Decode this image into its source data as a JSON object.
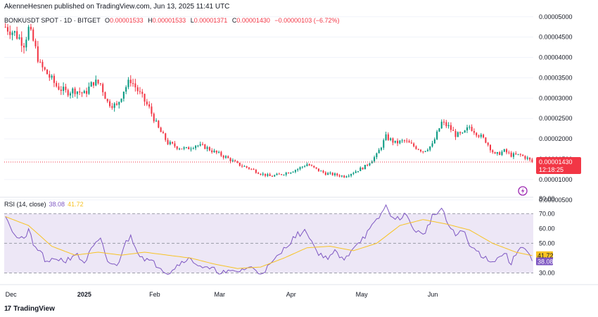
{
  "header": {
    "publisher": "AkenneHesnen published on TradingView.com, Jun 13, 2025 11:41 UTC"
  },
  "legend": {
    "symbol": "BONKUSDT SPOT · 1D · BITGET",
    "open_label": "O",
    "open": "0.00001533",
    "high_label": "H",
    "high": "0.00001533",
    "low_label": "L",
    "low": "0.00001371",
    "close_label": "C",
    "close": "0.00001430",
    "change": "−0.00000103 (−6.72%)"
  },
  "rsi_legend": {
    "label": "RSI (14, close)",
    "rsi_value": "38.08",
    "ma_value": "41.72"
  },
  "footer": {
    "brand": "TradingView",
    "logo": "17"
  },
  "colors": {
    "up": "#089981",
    "down": "#f23645",
    "rsi": "#7e57c2",
    "rsi_ma": "#f7c325",
    "band": "#ede7f6"
  },
  "icons": {
    "alert": "lightning-icon"
  },
  "chart_data": [
    {
      "type": "candlestick",
      "ylim": [
        6e-06,
        5.1e-05
      ],
      "y_ticks": [
        "0.00005000",
        "0.00004500",
        "0.00004000",
        "0.00003500",
        "0.00003000",
        "0.00002500",
        "0.00002000",
        "0.00001500",
        "0.00001000",
        "0.00000500"
      ],
      "x_ticks": [
        "Dec",
        "2025",
        "Feb",
        "Mar",
        "Apr",
        "May",
        "Jun"
      ],
      "last_price_label": "0.00001430",
      "countdown": "12:18:25",
      "price_path": [
        [
          0,
          4.75e-05
        ],
        [
          4,
          4.6e-05
        ],
        [
          8,
          4.35e-05
        ],
        [
          10,
          4.7e-05
        ],
        [
          12,
          4.4e-05
        ],
        [
          15,
          3.8e-05
        ],
        [
          18,
          3.6e-05
        ],
        [
          22,
          3.3e-05
        ],
        [
          26,
          3.15e-05
        ],
        [
          30,
          3.2e-05
        ],
        [
          34,
          3.1e-05
        ],
        [
          38,
          3.4e-05
        ],
        [
          41,
          3.35e-05
        ],
        [
          44,
          2.9e-05
        ],
        [
          48,
          2.8e-05
        ],
        [
          51,
          3.2e-05
        ],
        [
          54,
          3.45e-05
        ],
        [
          58,
          3.1e-05
        ],
        [
          62,
          2.75e-05
        ],
        [
          66,
          2.25e-05
        ],
        [
          70,
          1.9e-05
        ],
        [
          74,
          1.8e-05
        ],
        [
          78,
          1.75e-05
        ],
        [
          82,
          1.85e-05
        ],
        [
          86,
          1.8e-05
        ],
        [
          90,
          1.68e-05
        ],
        [
          95,
          1.55e-05
        ],
        [
          100,
          1.38e-05
        ],
        [
          105,
          1.28e-05
        ],
        [
          110,
          1.15e-05
        ],
        [
          114,
          1.08e-05
        ],
        [
          118,
          1.12e-05
        ],
        [
          122,
          1.18e-05
        ],
        [
          126,
          1.26e-05
        ],
        [
          130,
          1.38e-05
        ],
        [
          134,
          1.25e-05
        ],
        [
          138,
          1.15e-05
        ],
        [
          142,
          1.12e-05
        ],
        [
          146,
          1.08e-05
        ],
        [
          150,
          1.18e-05
        ],
        [
          155,
          1.32e-05
        ],
        [
          160,
          1.6e-05
        ],
        [
          164,
          2.05e-05
        ],
        [
          168,
          1.9e-05
        ],
        [
          172,
          1.95e-05
        ],
        [
          176,
          1.82e-05
        ],
        [
          180,
          1.7e-05
        ],
        [
          184,
          1.85e-05
        ],
        [
          188,
          2.4e-05
        ],
        [
          191,
          2.3e-05
        ],
        [
          194,
          2.1e-05
        ],
        [
          197,
          2.1e-05
        ],
        [
          200,
          2.3e-05
        ],
        [
          203,
          2.15e-05
        ],
        [
          207,
          1.95e-05
        ],
        [
          211,
          1.6e-05
        ],
        [
          215,
          1.7e-05
        ],
        [
          218,
          1.6e-05
        ],
        [
          222,
          1.6e-05
        ],
        [
          225,
          1.52e-05
        ],
        [
          227,
          1.43e-05
        ]
      ]
    },
    {
      "type": "line",
      "title": "RSI (14, close)",
      "ylim": [
        25,
        82
      ],
      "y_ticks": [
        "80.00",
        "70.00",
        "60.00",
        "50.00",
        "30.00"
      ],
      "bands": [
        30,
        50,
        70
      ],
      "current_rsi": 38.08,
      "current_ma": 41.72,
      "rsi_path": [
        [
          0,
          70
        ],
        [
          4,
          55
        ],
        [
          8,
          52
        ],
        [
          10,
          60
        ],
        [
          12,
          48
        ],
        [
          15,
          45
        ],
        [
          18,
          36
        ],
        [
          22,
          40
        ],
        [
          26,
          38
        ],
        [
          30,
          43
        ],
        [
          34,
          37
        ],
        [
          38,
          48
        ],
        [
          41,
          52
        ],
        [
          44,
          38
        ],
        [
          48,
          34
        ],
        [
          51,
          48
        ],
        [
          54,
          55
        ],
        [
          58,
          42
        ],
        [
          62,
          38
        ],
        [
          66,
          35
        ],
        [
          70,
          30
        ],
        [
          74,
          35
        ],
        [
          78,
          40
        ],
        [
          82,
          37
        ],
        [
          86,
          33
        ],
        [
          90,
          32
        ],
        [
          95,
          30
        ],
        [
          100,
          31
        ],
        [
          105,
          34
        ],
        [
          110,
          30
        ],
        [
          114,
          35
        ],
        [
          118,
          42
        ],
        [
          122,
          50
        ],
        [
          126,
          56
        ],
        [
          130,
          58
        ],
        [
          134,
          45
        ],
        [
          138,
          40
        ],
        [
          142,
          44
        ],
        [
          146,
          38
        ],
        [
          150,
          48
        ],
        [
          155,
          55
        ],
        [
          160,
          65
        ],
        [
          164,
          75
        ],
        [
          168,
          65
        ],
        [
          172,
          70
        ],
        [
          176,
          60
        ],
        [
          180,
          55
        ],
        [
          184,
          68
        ],
        [
          188,
          73
        ],
        [
          191,
          62
        ],
        [
          194,
          55
        ],
        [
          197,
          60
        ],
        [
          200,
          48
        ],
        [
          203,
          45
        ],
        [
          207,
          40
        ],
        [
          211,
          38
        ],
        [
          215,
          44
        ],
        [
          218,
          36
        ],
        [
          222,
          49
        ],
        [
          225,
          44
        ],
        [
          227,
          38
        ]
      ],
      "ma_path": [
        [
          0,
          68
        ],
        [
          10,
          62
        ],
        [
          20,
          48
        ],
        [
          30,
          42
        ],
        [
          40,
          44
        ],
        [
          50,
          42
        ],
        [
          60,
          44
        ],
        [
          70,
          42
        ],
        [
          80,
          40
        ],
        [
          90,
          36
        ],
        [
          100,
          33
        ],
        [
          110,
          34
        ],
        [
          120,
          40
        ],
        [
          130,
          47
        ],
        [
          140,
          48
        ],
        [
          150,
          45
        ],
        [
          160,
          50
        ],
        [
          170,
          62
        ],
        [
          180,
          66
        ],
        [
          190,
          63
        ],
        [
          200,
          59
        ],
        [
          210,
          50
        ],
        [
          220,
          44
        ],
        [
          227,
          41.7
        ]
      ]
    }
  ]
}
